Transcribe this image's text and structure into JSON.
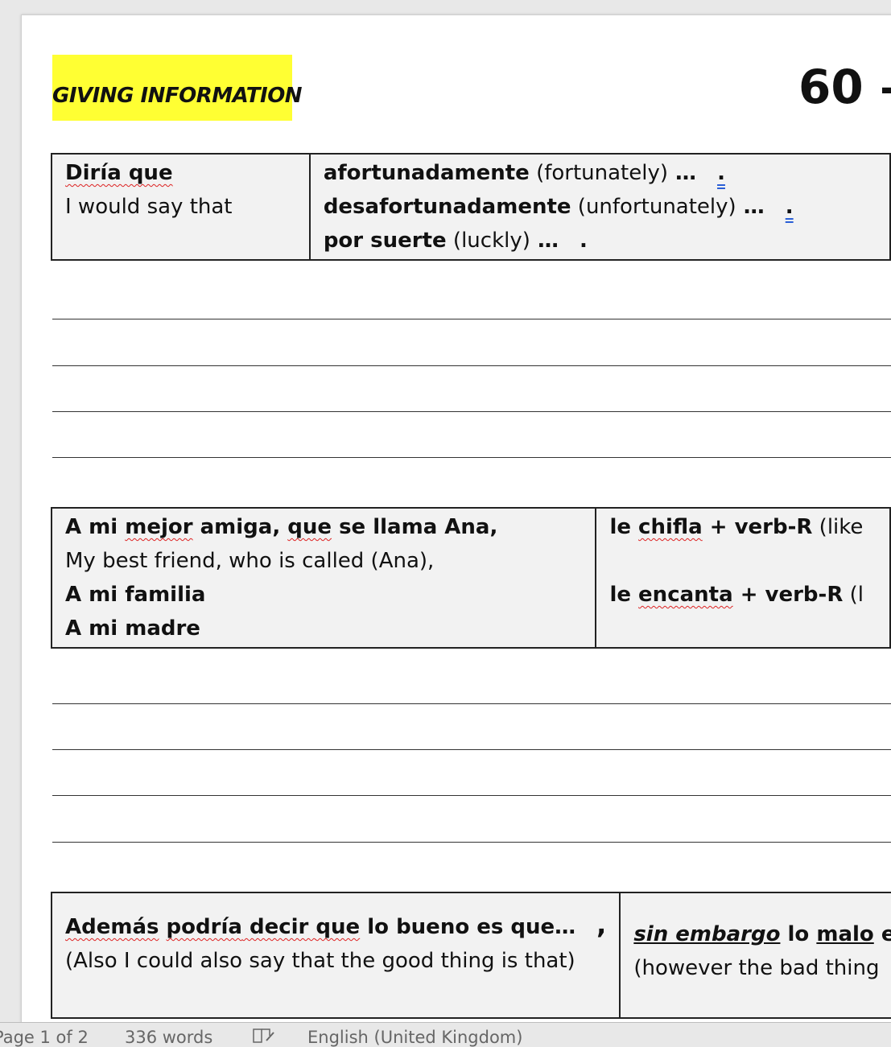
{
  "document": {
    "heading": "GIVING INFORMATION",
    "time_title": "60 –",
    "box1": {
      "left_bold": "Diría que",
      "left_trans": "I would say that",
      "rows": [
        {
          "bold": "afortunadamente",
          "trans": " (fortunately)",
          "ellipsis": " …",
          "end": "."
        },
        {
          "bold": "desafortunadamente",
          "trans": " (unfortunately)",
          "ellipsis": " …",
          "end": "."
        },
        {
          "bold": "por suerte",
          "trans": " (luckly)",
          "ellipsis": " …",
          "end": "."
        }
      ]
    },
    "box2": {
      "line1_a": "A mi ",
      "line1_b": "mejor",
      "line1_c": " amiga, ",
      "line1_d": "que",
      "line1_e": " se llama Ana,",
      "line2": "My best friend, who is called (Ana),",
      "line3": "A mi familia",
      "line4": "A mi madre",
      "right1_a": "le ",
      "right1_b": "chifla",
      "right1_c": " + verb-R",
      "right1_d": " (like",
      "right2_a": "le ",
      "right2_b": "encanta",
      "right2_c": " + verb-R",
      "right2_d": " (l"
    },
    "box3": {
      "l1_a": "Además",
      "l1_b": " ",
      "l1_c": "podría",
      "l1_d": " decir ",
      "l1_e": "que",
      "l1_f": " lo bueno es que…",
      "l1_comma": ",",
      "l2": "(Also I could also say that the good thing is that)",
      "r1_a": "sin embargo",
      "r1_b": " lo ",
      "r1_c": "malo",
      "r1_d": " es",
      "r2": "(however the bad thing"
    }
  },
  "status_bar": {
    "page": "Page 1 of 2",
    "words": "336 words",
    "language": "English (United Kingdom)"
  }
}
